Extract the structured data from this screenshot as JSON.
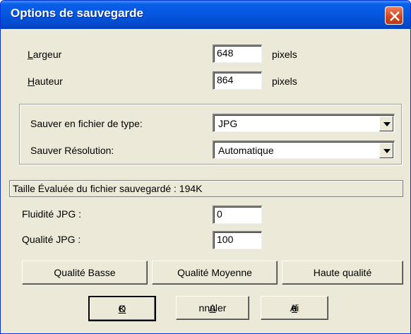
{
  "dialog": {
    "title": "Options de sauvegarde"
  },
  "dimensions": {
    "width_label_first": "L",
    "width_label_rest": "argeur",
    "width_value": "648",
    "width_unit": "pixels",
    "height_label_first": "H",
    "height_label_rest": "auteur",
    "height_value": "864",
    "height_unit": "pixels"
  },
  "save_group": {
    "type_label": "Sauver en fichier de type:",
    "type_value": "JPG",
    "resolution_label": "Sauver Résolution:",
    "resolution_value": "Automatique"
  },
  "estimate_text": "Taille Évaluée du fichier sauvegardé : 194K",
  "jpg": {
    "smoothing_label": "Fluidité JPG :",
    "smoothing_value": "0",
    "quality_label": "Qualité JPG :",
    "quality_value": "100"
  },
  "presets": {
    "low": "Qualité Basse",
    "medium": "Qualité Moyenne",
    "high": "Haute qualité"
  },
  "actions": {
    "ok_first": "O",
    "ok_rest": "K",
    "cancel_first": "A",
    "cancel_rest": "nnuler",
    "help_before": "Ai",
    "help_underlined": "d",
    "help_after": "e"
  },
  "colors": {
    "titlebar": "#0556e0",
    "dialog_bg": "#ece9d8",
    "close_button": "#d3431a"
  },
  "icons": {
    "close": "close-icon",
    "dropdown": "chevron-down-icon"
  }
}
